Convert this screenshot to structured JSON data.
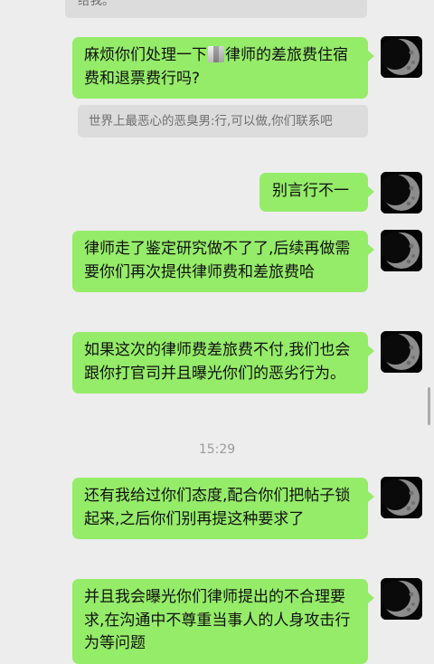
{
  "messages": [
    {
      "id": "partial-top",
      "text": "给我。"
    },
    {
      "id": "msg1",
      "text_before": "麻烦你们处理一下",
      "text_after": "律师的差旅费住宿费和退票费行吗?"
    },
    {
      "id": "quote1",
      "text": "世界上最恶心的恶臭男:行,可以做,你们联系吧"
    },
    {
      "id": "msg2",
      "text": "别言行不一"
    },
    {
      "id": "msg3",
      "text": "律师走了鉴定研究做不了了,后续再做需要你们再次提供律师费和差旅费哈"
    },
    {
      "id": "msg4",
      "text": "如果这次的律师费差旅费不付,我们也会跟你打官司并且曝光你们的恶劣行为。"
    },
    {
      "id": "msg5",
      "text": "还有我给过你们态度,配合你们把帖子锁起来,之后你们别再提这种要求了"
    },
    {
      "id": "msg6",
      "text": "并且我会曝光你们律师提出的不合理要求,在沟通中不尊重当事人的人身攻击行为等问题"
    }
  ],
  "timestamp": "15:29",
  "colors": {
    "background": "#ededed",
    "bubble_self": "#95ec69",
    "quote_bg": "#dcdcdc",
    "timestamp_text": "#9b9b9b"
  },
  "icons": {
    "avatar": "moon-avatar-icon",
    "redaction": "mosaic-redaction-icon"
  }
}
